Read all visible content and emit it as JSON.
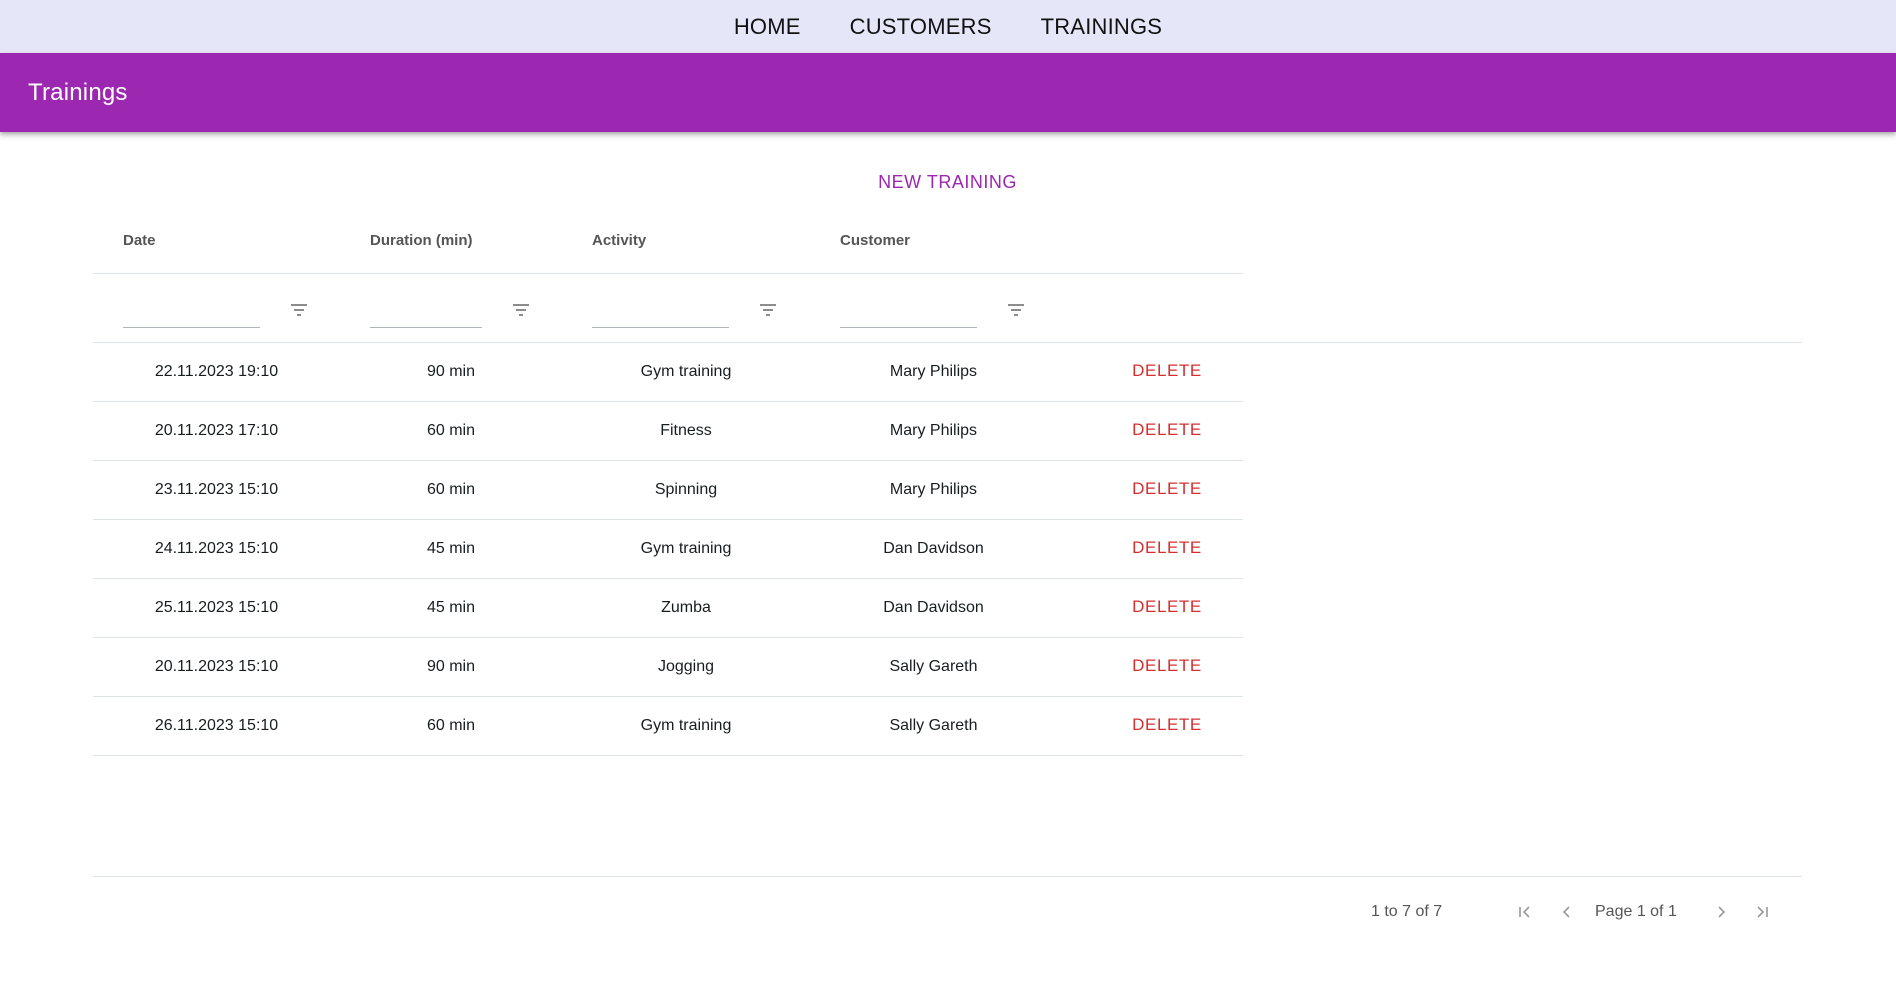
{
  "nav": {
    "home": "HOME",
    "customers": "CUSTOMERS",
    "trainings": "TRAININGS"
  },
  "appbar": {
    "title": "Trainings"
  },
  "actions": {
    "new_training": "NEW TRAINING"
  },
  "table": {
    "columns": [
      "Date",
      "Duration (min)",
      "Activity",
      "Customer"
    ],
    "delete_label": "DELETE",
    "rows": [
      {
        "date": "22.11.2023 19:10",
        "duration": "90 min",
        "activity": "Gym training",
        "customer": "Mary Philips"
      },
      {
        "date": "20.11.2023 17:10",
        "duration": "60 min",
        "activity": "Fitness",
        "customer": "Mary Philips"
      },
      {
        "date": "23.11.2023 15:10",
        "duration": "60 min",
        "activity": "Spinning",
        "customer": "Mary Philips"
      },
      {
        "date": "24.11.2023 15:10",
        "duration": "45 min",
        "activity": "Gym training",
        "customer": "Dan Davidson"
      },
      {
        "date": "25.11.2023 15:10",
        "duration": "45 min",
        "activity": "Zumba",
        "customer": "Dan Davidson"
      },
      {
        "date": "20.11.2023 15:10",
        "duration": "90 min",
        "activity": "Jogging",
        "customer": "Sally Gareth"
      },
      {
        "date": "26.11.2023 15:10",
        "duration": "60 min",
        "activity": "Gym training",
        "customer": "Sally Gareth"
      }
    ]
  },
  "pagination": {
    "summary": "1 to 7 of 7",
    "page_text": "Page 1 of 1"
  },
  "icons": {
    "filter": "filter-icon",
    "first": "first-page-icon",
    "prev": "previous-page-icon",
    "next": "next-page-icon",
    "last": "last-page-icon"
  },
  "colors": {
    "accent": "#9c27b0",
    "nav_bg": "#e5e7f8",
    "delete": "#d32f2f"
  }
}
